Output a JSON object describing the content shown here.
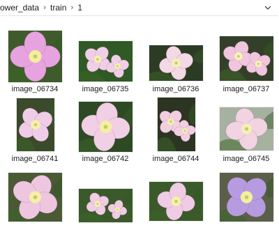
{
  "breadcrumb": {
    "items": [
      "ower_data",
      "train",
      "1"
    ],
    "separator": "›"
  },
  "files": [
    {
      "name": "image_06734",
      "flower": "#e7a3df",
      "center": "#f3ef9a",
      "bg": "#3f5b2b"
    },
    {
      "name": "image_06735",
      "flower": "#f0cfe6",
      "center": "#f4f2a8",
      "bg": "#2f5a25"
    },
    {
      "name": "image_06736",
      "flower": "#f3d9e3",
      "center": "#f5f0b2",
      "bg": "#2c3b24"
    },
    {
      "name": "image_06737",
      "flower": "#f0c5de",
      "center": "#f6f3b0",
      "bg": "#334029"
    },
    {
      "name": "image_06741",
      "flower": "#f0cde6",
      "center": "#f5f1a8",
      "bg": "#3a4a2b"
    },
    {
      "name": "image_06742",
      "flower": "#f1cfe5",
      "center": "#f3f0a0",
      "bg": "#2e4a24"
    },
    {
      "name": "image_06744",
      "flower": "#f2cfe0",
      "center": "#f2efb0",
      "bg": "#2c3422"
    },
    {
      "name": "image_06745",
      "flower": "#f2d3e1",
      "center": "#f3f0b4",
      "bg": "#a7b1a0"
    },
    {
      "name": "",
      "flower": "#eec6e0",
      "center": "#f4f0a6",
      "bg": "#4a5a35"
    },
    {
      "name": "",
      "flower": "#f0cde3",
      "center": "#f4f0ac",
      "bg": "#3a5a2b"
    },
    {
      "name": "",
      "flower": "#f0cbe4",
      "center": "#f4f2a6",
      "bg": "#3a5a2a"
    },
    {
      "name": "",
      "flower": "#b79be0",
      "center": "#f0f29a",
      "bg": "#5a5f4a"
    }
  ]
}
